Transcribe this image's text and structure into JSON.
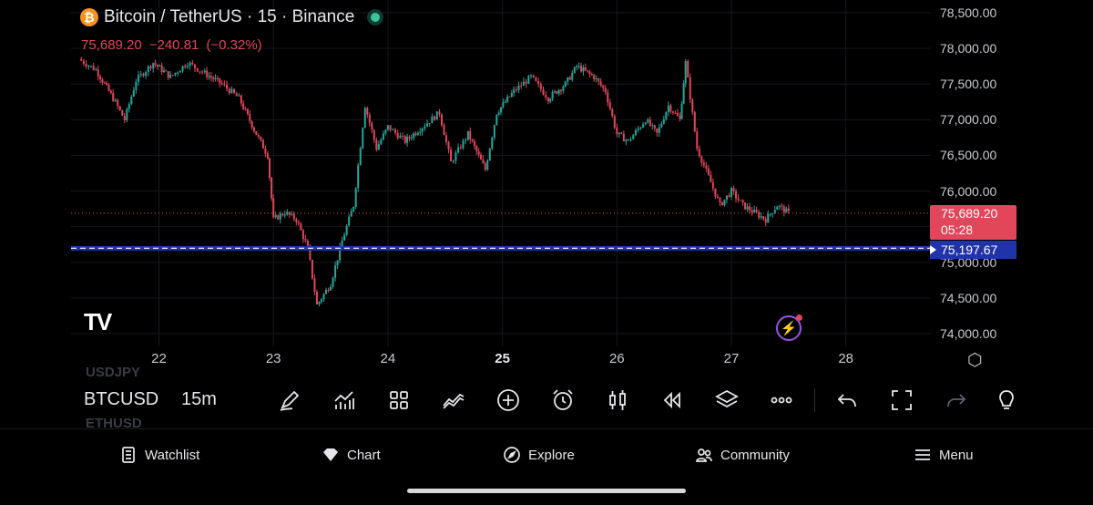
{
  "header": {
    "title": "Bitcoin / TetherUS · 15 · Binance",
    "coin_icon": "₿",
    "price": "75,689.20",
    "change": "−240.81",
    "change_pct": "(−0.32%)"
  },
  "price_axis": [
    "78,500.00",
    "78,000.00",
    "77,500.00",
    "77,000.00",
    "76,500.00",
    "76,000.00",
    "75,500.00",
    "75,000.00",
    "74,500.00",
    "74,000.00"
  ],
  "time_axis": [
    {
      "label": "22",
      "bold": false
    },
    {
      "label": "23",
      "bold": false
    },
    {
      "label": "24",
      "bold": false
    },
    {
      "label": "25",
      "bold": true
    },
    {
      "label": "26",
      "bold": false
    },
    {
      "label": "27",
      "bold": false
    },
    {
      "label": "28",
      "bold": false
    }
  ],
  "last_price_badge": {
    "price": "75,689.20",
    "countdown": "05:28"
  },
  "horizontal_line": {
    "price": "75,197.67"
  },
  "toolbar": {
    "symbol": "BTCUSD",
    "interval": "15m",
    "ghost_above": "USDJPY",
    "ghost_below": "ETHUSD"
  },
  "bottom_nav": [
    {
      "label": "Watchlist"
    },
    {
      "label": "Chart"
    },
    {
      "label": "Explore"
    },
    {
      "label": "Community"
    },
    {
      "label": "Menu"
    }
  ],
  "colors": {
    "up": "#26a69a",
    "down": "#e2465a",
    "line": "#2133a8",
    "accent": "#9b51e0"
  },
  "chart_data": {
    "type": "candlestick",
    "ylim": [
      74000,
      78500
    ],
    "x_days": [
      21.3,
      28.9
    ],
    "series_close": [
      [
        21.3,
        77850
      ],
      [
        21.45,
        77700
      ],
      [
        21.6,
        77300
      ],
      [
        21.7,
        77000
      ],
      [
        21.8,
        77550
      ],
      [
        21.95,
        77800
      ],
      [
        22.1,
        77600
      ],
      [
        22.25,
        77800
      ],
      [
        22.4,
        77650
      ],
      [
        22.55,
        77500
      ],
      [
        22.7,
        77300
      ],
      [
        22.85,
        76800
      ],
      [
        22.95,
        76500
      ],
      [
        23.0,
        75600
      ],
      [
        23.1,
        75700
      ],
      [
        23.2,
        75600
      ],
      [
        23.3,
        75200
      ],
      [
        23.38,
        74400
      ],
      [
        23.5,
        74700
      ],
      [
        23.6,
        75300
      ],
      [
        23.7,
        75800
      ],
      [
        23.8,
        77200
      ],
      [
        23.9,
        76600
      ],
      [
        24.0,
        76900
      ],
      [
        24.15,
        76700
      ],
      [
        24.3,
        76900
      ],
      [
        24.45,
        77100
      ],
      [
        24.55,
        76400
      ],
      [
        24.7,
        76800
      ],
      [
        24.85,
        76300
      ],
      [
        24.95,
        77100
      ],
      [
        25.1,
        77400
      ],
      [
        25.25,
        77600
      ],
      [
        25.4,
        77300
      ],
      [
        25.55,
        77500
      ],
      [
        25.65,
        77750
      ],
      [
        25.8,
        77600
      ],
      [
        25.9,
        77400
      ],
      [
        26.0,
        76800
      ],
      [
        26.1,
        76700
      ],
      [
        26.25,
        77000
      ],
      [
        26.35,
        76800
      ],
      [
        26.45,
        77200
      ],
      [
        26.55,
        77000
      ],
      [
        26.6,
        77800
      ],
      [
        26.7,
        76600
      ],
      [
        26.8,
        76200
      ],
      [
        26.9,
        75800
      ],
      [
        27.0,
        76000
      ],
      [
        27.1,
        75800
      ],
      [
        27.2,
        75700
      ],
      [
        27.3,
        75600
      ],
      [
        27.4,
        75800
      ],
      [
        27.5,
        75689.2
      ]
    ],
    "last_price": 75689.2,
    "hline": 75197.67
  }
}
